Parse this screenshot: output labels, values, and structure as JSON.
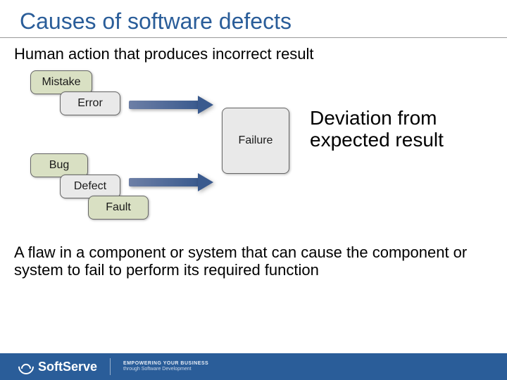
{
  "title": "Causes of software defects",
  "subtitle": "Human action that produces incorrect result",
  "boxes": {
    "mistake": "Mistake",
    "error": "Error",
    "bug": "Bug",
    "defect": "Defect",
    "fault": "Fault",
    "failure": "Failure"
  },
  "deviation": {
    "line1": "Deviation from",
    "line2": "expected result"
  },
  "bottom_text": "A flaw in a component or system that can cause the component or system to fail to perform its required function",
  "footer": {
    "brand": "SoftServe",
    "tagline1": "EMPOWERING YOUR BUSINESS",
    "tagline2": "through Software Development"
  },
  "chart_data": {
    "type": "diagram",
    "title": "Causes of software defects",
    "nodes": [
      {
        "id": "mistake",
        "label": "Mistake",
        "group": "human-action"
      },
      {
        "id": "error",
        "label": "Error",
        "group": "human-action"
      },
      {
        "id": "bug",
        "label": "Bug",
        "group": "flaw"
      },
      {
        "id": "defect",
        "label": "Defect",
        "group": "flaw"
      },
      {
        "id": "fault",
        "label": "Fault",
        "group": "flaw"
      },
      {
        "id": "failure",
        "label": "Failure",
        "group": "result"
      }
    ],
    "edges": [
      {
        "from": "error",
        "to": "failure"
      },
      {
        "from": "defect",
        "to": "failure"
      }
    ],
    "annotations": {
      "human-action": "Human action that produces incorrect result",
      "flaw": "A flaw in a component or system that can cause the component or system to fail to perform its required function",
      "failure": "Deviation from expected result"
    }
  }
}
